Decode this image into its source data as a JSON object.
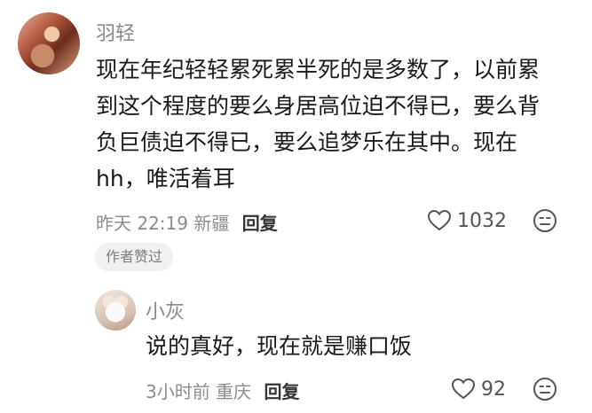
{
  "comment": {
    "username": "羽轻",
    "lines": [
      "现在年纪轻轻累死累半死的是多数了，以前累",
      "到这个程度的要么身居高位迫不得已，要么背",
      "负巨债迫不得已，要么追梦乐在其中。现在",
      "hh，唯活着耳"
    ],
    "time": "昨天 22:19",
    "location": "新疆",
    "reply_label": "回复",
    "like_count": "1032",
    "badge": "作者赞过"
  },
  "reply": {
    "username": "小灰",
    "text": "说的真好，现在就是赚口饭",
    "time": "3小时前",
    "location": "重庆",
    "reply_label": "回复",
    "like_count": "92"
  },
  "icons": {
    "like": "heart-outline-icon",
    "reaction": "emoji-face-icon"
  }
}
